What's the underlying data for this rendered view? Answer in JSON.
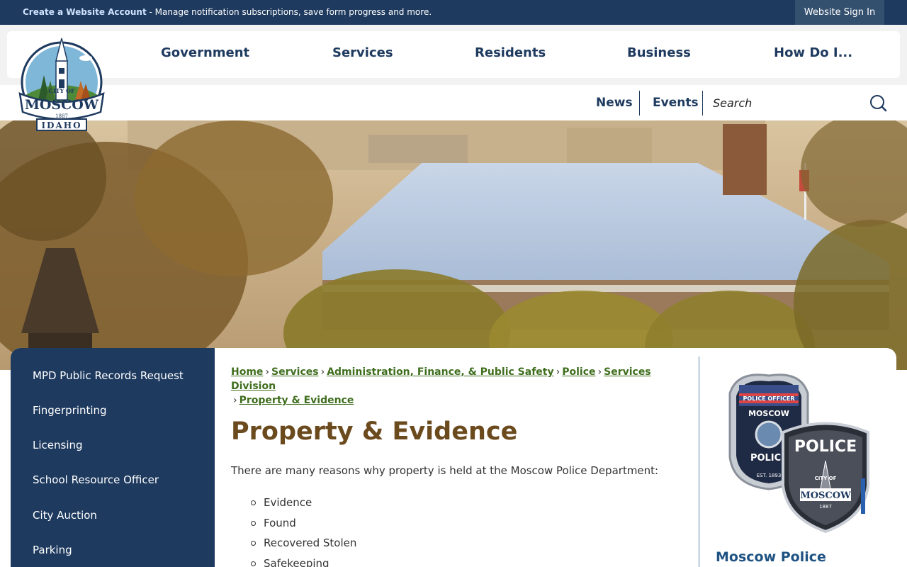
{
  "utility_bar": {
    "create_account_link": "Create a Website Account",
    "description": " - Manage notification subscriptions, save form progress and more.",
    "sign_in_button": "Website Sign In"
  },
  "logo": {
    "text_top": "CITY OF",
    "text_main": "MOSCOW",
    "year": "1887",
    "text_bottom": "IDAHO"
  },
  "main_nav": [
    "Government",
    "Services",
    "Residents",
    "Business",
    "How Do I..."
  ],
  "sub_nav": {
    "news": "News",
    "events": "Events",
    "search_placeholder": "Search"
  },
  "sidebar": {
    "items": [
      "MPD Public Records Request",
      "Fingerprinting",
      "Licensing",
      "School Resource Officer",
      "City Auction",
      "Parking"
    ]
  },
  "breadcrumb": {
    "items": [
      "Home",
      "Services",
      "Administration, Finance, & Public Safety",
      "Police",
      "Services Division",
      "Property & Evidence"
    ]
  },
  "page": {
    "title": "Property & Evidence",
    "intro": "There are many reasons why property is held at the Moscow Police Department:",
    "reasons": [
      "Evidence",
      "Found",
      "Recovered Stolen",
      "Safekeeping"
    ]
  },
  "right_panel": {
    "title": "Moscow Police",
    "badge_officer": {
      "line1": "POLICE OFFICER",
      "line2": "MOSCOW",
      "line3": "POLICE",
      "line4": "EST. 1893"
    },
    "badge_patch": {
      "line1": "POLICE",
      "line2": "CITY OF",
      "line3": "MOSCOW",
      "line4": "1887"
    }
  },
  "colors": {
    "navy": "#1e3a5f",
    "link_green": "#3f6e1e",
    "title_brown": "#6b4a1e",
    "panel_blue": "#1e5282"
  }
}
